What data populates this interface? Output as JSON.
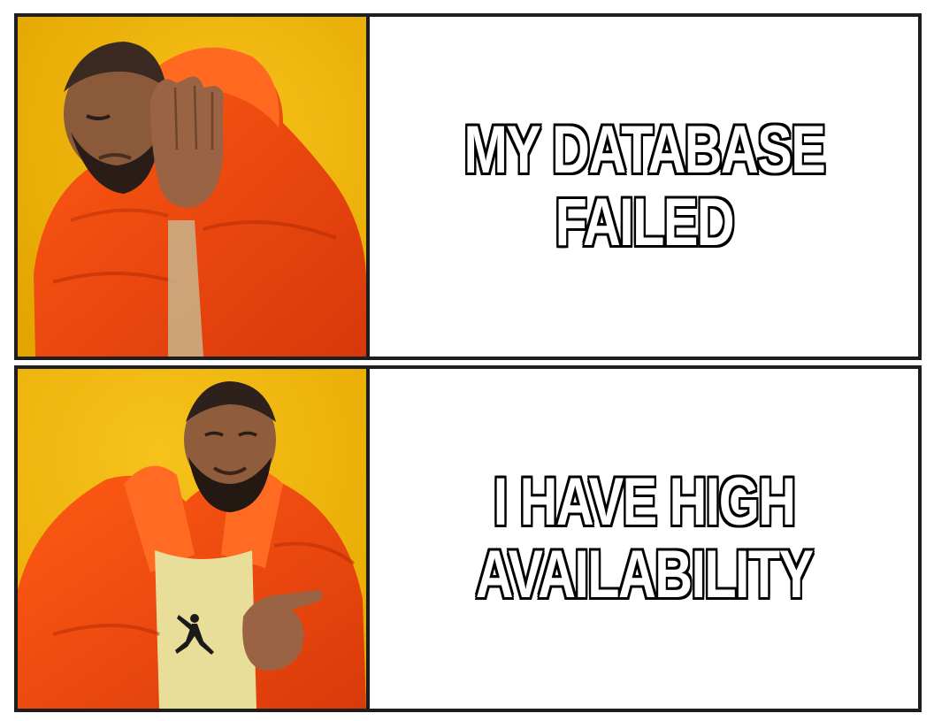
{
  "meme": {
    "top": {
      "caption_lines": [
        "MY DATABASE",
        "FAILED"
      ],
      "image": "man-rejecting-gesture"
    },
    "bottom": {
      "caption_lines": [
        "I HAVE HIGH",
        "AVAILABILITY"
      ],
      "image": "man-approving-gesture"
    }
  },
  "colors": {
    "border": "#1e1e1e",
    "background_yellow": "#f2b705",
    "jacket_orange": "#f24b0c",
    "caption_fill": "#ffffff",
    "caption_outline": "#000000"
  }
}
